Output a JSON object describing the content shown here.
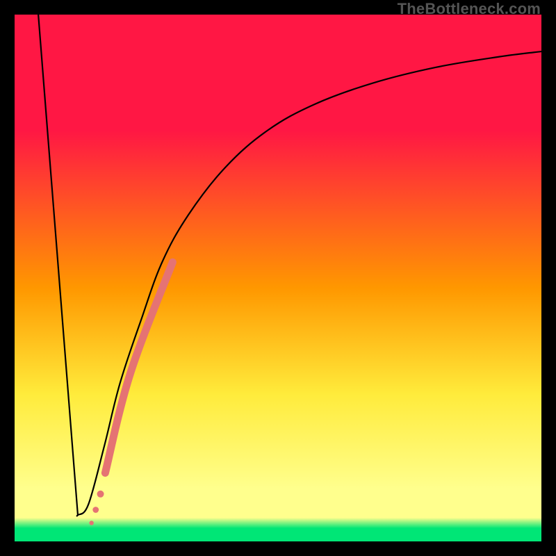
{
  "watermark": "TheBottleneck.com",
  "chart_data": {
    "type": "line",
    "title": "",
    "xlabel": "",
    "ylabel": "",
    "xlim": [
      0,
      100
    ],
    "ylim": [
      0,
      100
    ],
    "grid": false,
    "legend": false,
    "gradient_colors": {
      "top": "#ff1744",
      "upper_mid": "#ff9800",
      "mid": "#ffeb3b",
      "lower_mid": "#ffff8d",
      "bottom": "#00e676"
    },
    "series": [
      {
        "name": "left-falling-line",
        "color": "#000000",
        "x": [
          4.5,
          12.0
        ],
        "y": [
          100,
          5
        ]
      },
      {
        "name": "right-rising-curve",
        "color": "#000000",
        "x": [
          12,
          14,
          17,
          20,
          24,
          28,
          33,
          40,
          48,
          57,
          68,
          80,
          92,
          100
        ],
        "y": [
          5,
          7,
          18,
          30,
          42,
          53,
          62,
          71,
          78,
          83,
          87,
          90,
          92,
          93
        ]
      },
      {
        "name": "red-dotted-segment",
        "color": "#e57373",
        "x": [
          14.6,
          15.4,
          16.3,
          17.2,
          22.0,
          30.0
        ],
        "y": [
          3.5,
          6.0,
          9.0,
          13.0,
          32.0,
          53.0
        ]
      }
    ]
  }
}
